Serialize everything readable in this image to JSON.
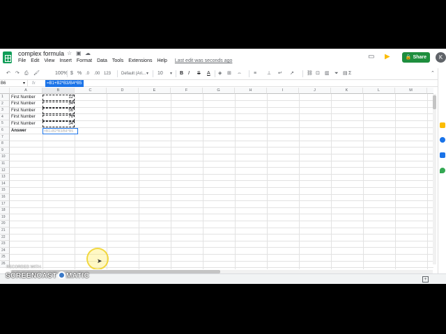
{
  "app": {
    "doc_title": "complex formula",
    "menu": [
      "File",
      "Edit",
      "View",
      "Insert",
      "Format",
      "Data",
      "Tools",
      "Extensions",
      "Help"
    ],
    "last_edit": "Last edit was seconds ago",
    "share_label": "Share",
    "avatar_initial": "K"
  },
  "toolbar": {
    "zoom": "100%",
    "currency": "$",
    "percent": "%",
    "decimal_dec": ".0",
    "decimal_inc": ".00",
    "more_formats": "123",
    "font": "Default (Ari...",
    "font_size": "10",
    "bold": "B",
    "italic": "I",
    "strike": "S",
    "text_color": "A",
    "functions": "Σ"
  },
  "formula_bar": {
    "name_box": "B6",
    "fx": "fx",
    "value": "=B1+B2*B3/B4^B5"
  },
  "grid": {
    "columns": [
      "A",
      "B",
      "C",
      "D",
      "E",
      "F",
      "G",
      "H",
      "I",
      "J",
      "K",
      "L",
      "M"
    ],
    "rows": [
      "1",
      "2",
      "3",
      "4",
      "5",
      "6",
      "7",
      "8",
      "9",
      "10",
      "11",
      "12",
      "13",
      "14",
      "15",
      "16",
      "17",
      "18",
      "19",
      "20",
      "21",
      "22",
      "23",
      "24",
      "25",
      "26"
    ],
    "cells": {
      "a1": "First Number",
      "a2": "First Number",
      "a3": "First Number",
      "a4": "First Number",
      "a5": "First Number",
      "a6": "Answer",
      "b1": "12",
      "b2": "34",
      "b3": "56",
      "b4": "76",
      "b5": "34",
      "b6": "=B1+B2*B3/B4^B5"
    }
  },
  "watermark": {
    "small": "RECORDED WITH",
    "big_left": "SCREENCAST",
    "big_right": "MATIC"
  },
  "colors": {
    "brand_green": "#0f9d58",
    "share_green": "#1e8e3e",
    "selection_blue": "#1a73e8"
  }
}
